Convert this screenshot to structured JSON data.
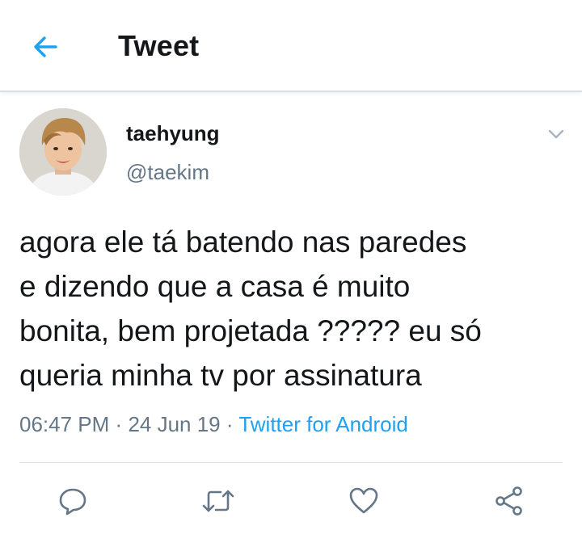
{
  "header": {
    "title": "Tweet",
    "back_icon": "arrow-left-icon"
  },
  "tweet": {
    "author": {
      "display_name": "taehyung",
      "handle": "@taekim",
      "avatar": "profile-photo"
    },
    "text": "agora ele tá batendo nas paredes\ne dizendo que a casa é muito\nbonita, bem projetada ????? eu só\nqueria minha tv por assinatura",
    "time": "06:47 PM",
    "date": "24 Jun 19",
    "separator": "·",
    "source": "Twitter for Android",
    "menu_icon": "chevron-down-icon"
  },
  "actions": [
    {
      "icon": "reply-icon"
    },
    {
      "icon": "retweet-icon"
    },
    {
      "icon": "like-icon"
    },
    {
      "icon": "share-icon"
    }
  ],
  "colors": {
    "accent": "#1da1f2",
    "text": "#14171a",
    "secondary": "#657786",
    "icon": "#657786",
    "divider": "#dcdfe2"
  }
}
